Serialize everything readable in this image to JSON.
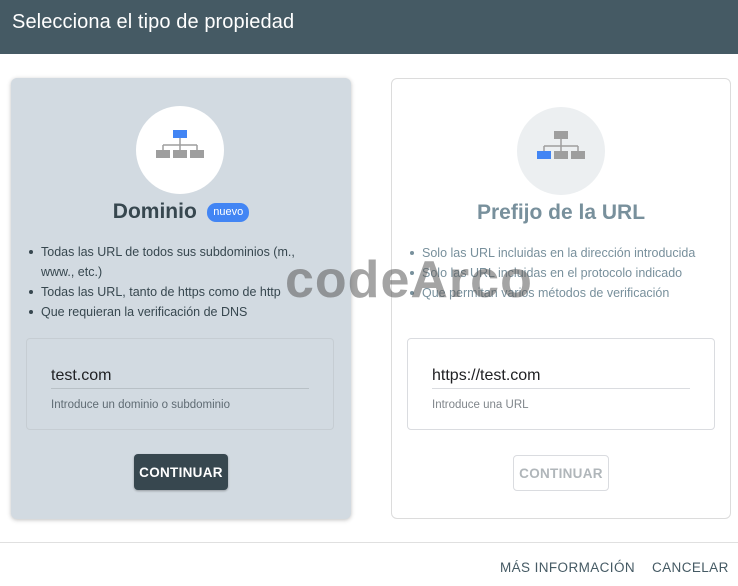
{
  "header": {
    "title": "Selecciona el tipo de propiedad"
  },
  "domain_card": {
    "icon": "network-tree-icon",
    "title": "Dominio",
    "badge": "nuevo",
    "bullets": [
      "Todas las URL de todos sus subdominios (m., www., etc.)",
      "Todas las URL, tanto de https como de http",
      "Que requieran la verificación de DNS"
    ],
    "input_value": "test.com",
    "input_hint": "Introduce un dominio o subdominio",
    "button_label": "CONTINUAR"
  },
  "prefix_card": {
    "icon": "network-tree-icon",
    "title": "Prefijo de la URL",
    "bullets": [
      "Solo las URL incluidas en la dirección introducida",
      "Solo las URL incluidas en el protocolo indicado",
      "Que permitan varios métodos de verificación"
    ],
    "input_value": "https://test.com",
    "input_hint": "Introduce una URL",
    "button_label": "CONTINUAR"
  },
  "footer": {
    "more_info_label": "MÁS INFORMACIÓN",
    "cancel_label": "CANCELAR"
  },
  "watermark": "codeArco",
  "colors": {
    "header_bg": "#455a64",
    "accent_blue": "#4285f4",
    "domain_card_bg": "#d2dae1",
    "primary_button": "#37474f"
  }
}
